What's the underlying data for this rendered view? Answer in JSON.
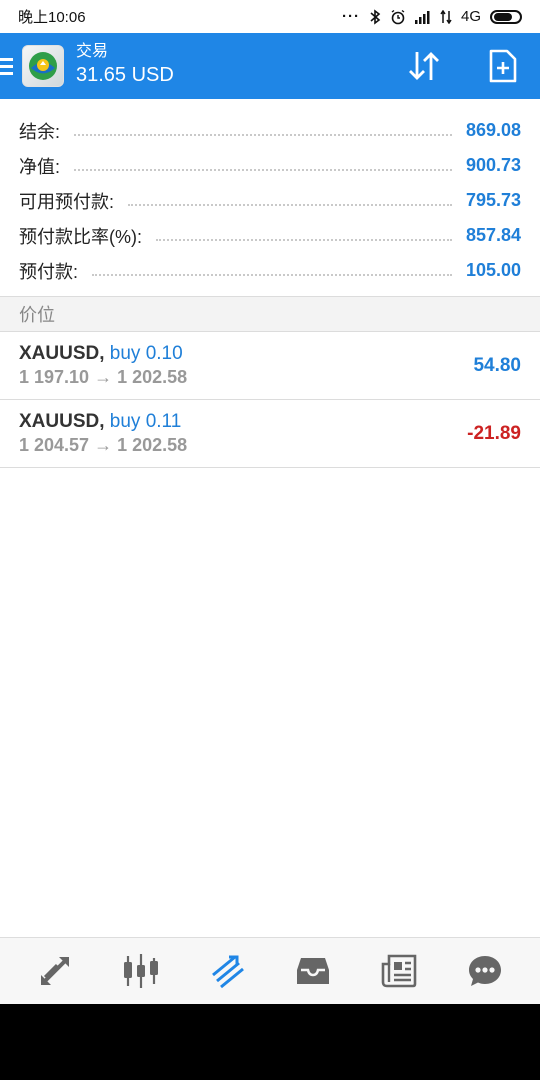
{
  "status_bar": {
    "time": "晚上10:06",
    "icons": [
      "dots-icon",
      "bluetooth-icon",
      "alarm-icon",
      "signal-icon",
      "data-arrows-icon",
      "battery-icon"
    ],
    "network": "4G"
  },
  "app_bar": {
    "title": "交易",
    "balance": "31.65 USD",
    "actions": [
      "sort-icon",
      "new-order-icon"
    ]
  },
  "summary": [
    {
      "label": "结余:",
      "value": "869.08"
    },
    {
      "label": "净值:",
      "value": "900.73"
    },
    {
      "label": "可用预付款:",
      "value": "795.73"
    },
    {
      "label": "预付款比率(%):",
      "value": "857.84"
    },
    {
      "label": "预付款:",
      "value": "105.00"
    }
  ],
  "section": {
    "title": "价位"
  },
  "positions": [
    {
      "symbol": "XAUUSD,",
      "side": "buy 0.10",
      "prices": "1 197.10 → 1 202.58",
      "profit": "54.80",
      "profit_sign": "positive"
    },
    {
      "symbol": "XAUUSD,",
      "side": "buy 0.11",
      "prices": "1 204.57 → 1 202.58",
      "profit": "-21.89",
      "profit_sign": "negative"
    }
  ],
  "bottom_nav": [
    {
      "name": "quotes-icon",
      "active": false
    },
    {
      "name": "chart-candles-icon",
      "active": false
    },
    {
      "name": "trade-icon",
      "active": true
    },
    {
      "name": "history-inbox-icon",
      "active": false
    },
    {
      "name": "news-icon",
      "active": false
    },
    {
      "name": "chat-icon",
      "active": false
    }
  ],
  "colors": {
    "accent": "#1f86e6",
    "positive": "#1f7fd8",
    "negative": "#cc2222",
    "nav_icon": "#666666"
  }
}
